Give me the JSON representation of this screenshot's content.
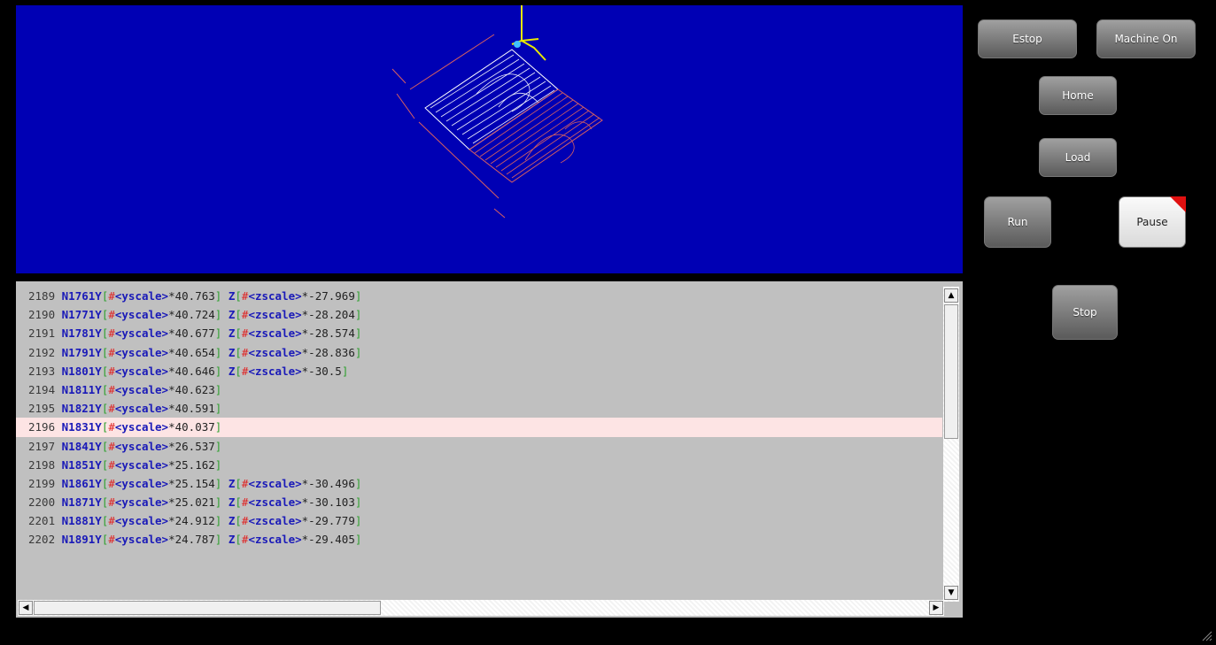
{
  "buttons": {
    "estop": "Estop",
    "machine_on": "Machine On",
    "home": "Home",
    "load": "Load",
    "run": "Run",
    "pause": "Pause",
    "stop": "Stop"
  },
  "code": {
    "current_line": "2196",
    "lines": [
      {
        "num": "2189",
        "n": "N1761",
        "y": "*40.763",
        "z": "*-27.969"
      },
      {
        "num": "2190",
        "n": "N1771",
        "y": "*40.724",
        "z": "*-28.204"
      },
      {
        "num": "2191",
        "n": "N1781",
        "y": "*40.677",
        "z": "*-28.574"
      },
      {
        "num": "2192",
        "n": "N1791",
        "y": "*40.654",
        "z": "*-28.836"
      },
      {
        "num": "2193",
        "n": "N1801",
        "y": "*40.646",
        "z": "*-30.5"
      },
      {
        "num": "2194",
        "n": "N1811",
        "y": "*40.623",
        "z": null
      },
      {
        "num": "2195",
        "n": "N1821",
        "y": "*40.591",
        "z": null
      },
      {
        "num": "2196",
        "n": "N1831",
        "y": "*40.037",
        "z": null
      },
      {
        "num": "2197",
        "n": "N1841",
        "y": "*26.537",
        "z": null
      },
      {
        "num": "2198",
        "n": "N1851",
        "y": "*25.162",
        "z": null
      },
      {
        "num": "2199",
        "n": "N1861",
        "y": "*25.154",
        "z": "*-30.496"
      },
      {
        "num": "2200",
        "n": "N1871",
        "y": "*25.021",
        "z": "*-30.103"
      },
      {
        "num": "2201",
        "n": "N1881",
        "y": "*24.912",
        "z": "*-29.779"
      },
      {
        "num": "2202",
        "n": "N1891",
        "y": "*24.787",
        "z": "*-29.405"
      }
    ],
    "tokens": {
      "y_axis": "Y",
      "z_axis": "Z",
      "open_bracket": "[",
      "close_bracket": "]",
      "hash": "#",
      "yscale": "<yscale>",
      "zscale": "<zscale>"
    }
  },
  "scrollbars": {
    "up_arrow": "▲",
    "down_arrow": "▼",
    "left_arrow": "◀",
    "right_arrow": "▶"
  },
  "colors": {
    "viewport_bg": "#0000b4",
    "toolpath_white": "#ffffff",
    "toolpath_red": "#d86060",
    "tool_yellow": "#e8e800",
    "highlight_row": "#fde4e4"
  },
  "icons": {
    "resize_grip": "resize-grip-icon",
    "pause_indicator": "red-corner-indicator"
  }
}
